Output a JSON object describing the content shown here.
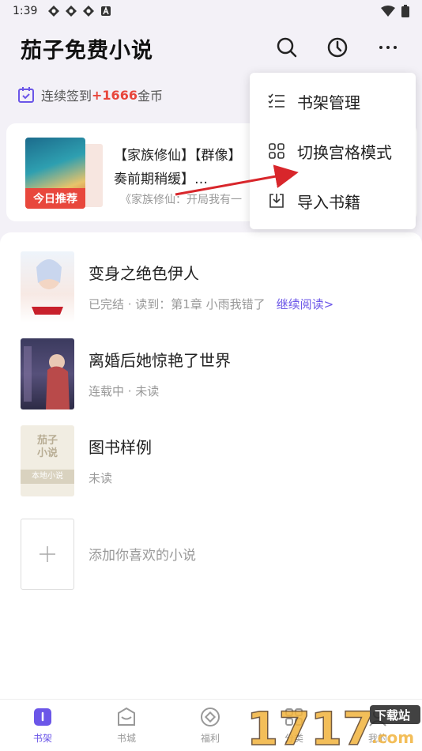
{
  "status": {
    "time": "1:39"
  },
  "header": {
    "title": "茄子免费小说"
  },
  "signin": {
    "prefix": "连续签到",
    "coins": "+1666",
    "suffix": "金币"
  },
  "recommend": {
    "badge": "今日推荐",
    "text": "【家族修仙】【群像】\n奏前期稍缓】…",
    "sub": "《家族修仙：开局我有一"
  },
  "menu": {
    "items": [
      {
        "label": "书架管理",
        "icon": "list-check-icon"
      },
      {
        "label": "切换宫格模式",
        "icon": "grid-icon"
      },
      {
        "label": "导入书籍",
        "icon": "import-icon"
      }
    ]
  },
  "books": [
    {
      "name": "变身之绝色伊人",
      "meta": "已完结 · 读到：第1章 小雨我错了",
      "action": "继续阅读>"
    },
    {
      "name": "离婚后她惊艳了世界",
      "meta": "连载中 · 未读"
    },
    {
      "name": "图书样例",
      "meta": "未读",
      "cover_top": "茄子",
      "cover_mid": "小说",
      "cover_band": "本地小说"
    }
  ],
  "add": {
    "label": "添加你喜欢的小说"
  },
  "tabs": [
    {
      "label": "书架",
      "active": true
    },
    {
      "label": "书城"
    },
    {
      "label": "福利"
    },
    {
      "label": "分类"
    },
    {
      "label": "我的"
    }
  ],
  "colors": {
    "accent": "#6b56e8",
    "red": "#e8473c"
  }
}
